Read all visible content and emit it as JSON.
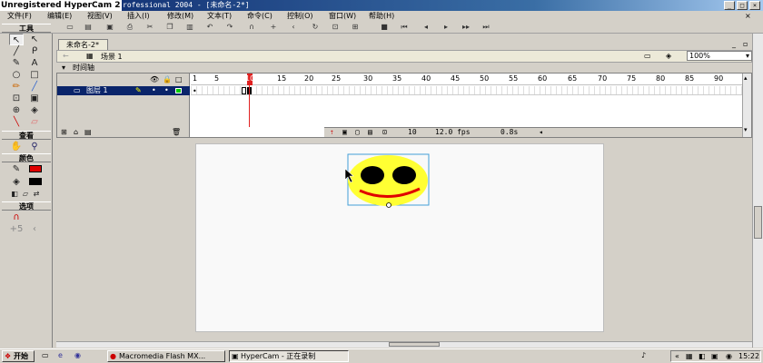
{
  "watermark": "Unregistered HyperCam 2",
  "window_title": "rofessional 2004 - [未命名-2*]",
  "menu": [
    "文件(F)",
    "编辑(E)",
    "视图(V)",
    "插入(I)",
    "修改(M)",
    "文本(T)",
    "命令(C)",
    "控制(O)",
    "窗口(W)",
    "帮助(H)"
  ],
  "tools": {
    "header": "工具",
    "view_header": "查看",
    "colors_header": "颜色",
    "options_header": "选项"
  },
  "doc_tab": "未命名-2*",
  "scene_label": "场景 1",
  "zoom": "100%",
  "timeline": {
    "header": "时间轴",
    "layer_name": "图层 1",
    "ruler_labels": [
      "1",
      "5",
      "10",
      "15",
      "20",
      "25",
      "30",
      "35",
      "40",
      "45",
      "50",
      "55",
      "60",
      "65",
      "70",
      "75",
      "80",
      "85",
      "90"
    ],
    "current_frame": "10",
    "fps": "12.0 fps",
    "elapsed": "0.8s"
  },
  "taskbar": {
    "start_label": "开始",
    "tasks": [
      "Macromedia Flash MX...",
      "HyperCam - 正在录制"
    ],
    "clock": "15:22"
  },
  "colors": {
    "stroke": "#e00000",
    "fill": "#000000",
    "smiley_face": "#ffff33",
    "smiley_mouth": "#e00000"
  }
}
